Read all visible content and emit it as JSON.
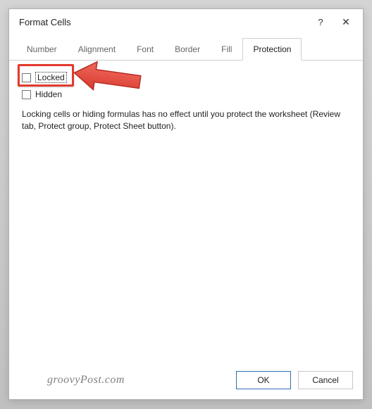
{
  "dialog": {
    "title": "Format Cells",
    "tabs": [
      "Number",
      "Alignment",
      "Font",
      "Border",
      "Fill",
      "Protection"
    ],
    "activeTabIndex": 5
  },
  "protection": {
    "locked_label": "Locked",
    "locked_checked": false,
    "hidden_label": "Hidden",
    "hidden_checked": false,
    "info_text": "Locking cells or hiding formulas has no effect until you protect the worksheet (Review tab, Protect group, Protect Sheet button)."
  },
  "buttons": {
    "ok": "OK",
    "cancel": "Cancel"
  },
  "watermark": "groovyPost.com",
  "colors": {
    "highlight": "#e33a2d",
    "arrow_fill": "#f04b3f",
    "arrow_stroke": "#b52c22"
  }
}
